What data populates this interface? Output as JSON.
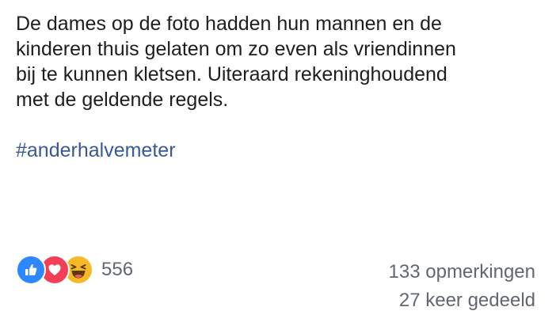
{
  "post": {
    "text": "De dames op de foto hadden hun mannen en de\nkinderen thuis gelaten om zo even als vriendinnen\nbij te kunnen kletsen. Uiteraard rekeninghoudend\nmet de geldende regels.",
    "hashtag": "#anderhalvemeter"
  },
  "reactions": {
    "icons": [
      "like-icon",
      "love-icon",
      "haha-icon"
    ],
    "count": "556"
  },
  "stats": {
    "comments": "133 opmerkingen",
    "shares": "27 keer gedeeld"
  },
  "colors": {
    "hashtag": "#385898",
    "like": "#2d88ff",
    "love": "#f33e58",
    "haha": "#f7b928",
    "meta_text": "#606770"
  }
}
